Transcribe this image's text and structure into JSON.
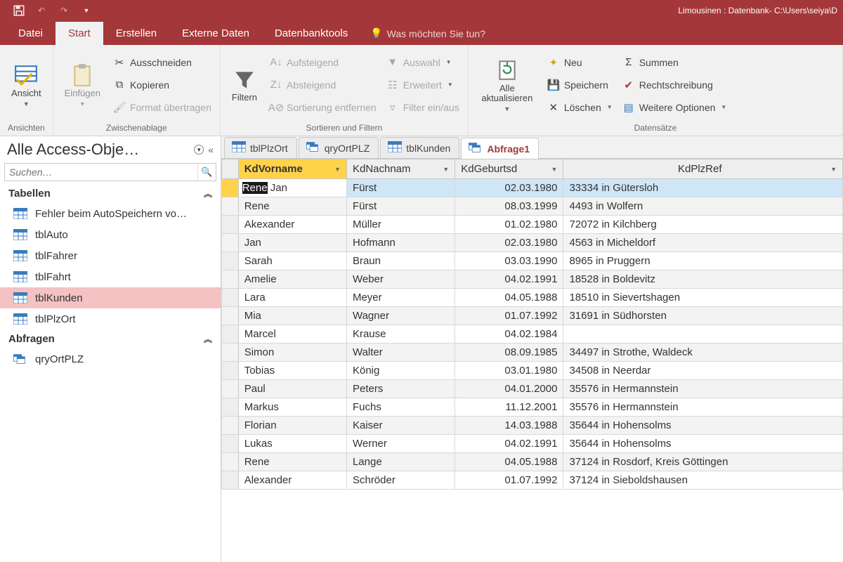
{
  "window": {
    "title": "Limousinen : Datenbank- C:\\Users\\seiya\\D"
  },
  "menu": {
    "tabs": [
      "Datei",
      "Start",
      "Erstellen",
      "Externe Daten",
      "Datenbanktools"
    ],
    "tell_me": "Was möchten Sie tun?"
  },
  "ribbon": {
    "ansichten": {
      "ansicht": "Ansicht",
      "group": "Ansichten"
    },
    "clipboard": {
      "einfuegen": "Einfügen",
      "ausschneiden": "Ausschneiden",
      "kopieren": "Kopieren",
      "format": "Format übertragen",
      "group": "Zwischenablage"
    },
    "sortfilter": {
      "filtern": "Filtern",
      "auf": "Aufsteigend",
      "ab": "Absteigend",
      "entf": "Sortierung entfernen",
      "auswahl": "Auswahl",
      "erweitert": "Erweitert",
      "einaus": "Filter ein/aus",
      "group": "Sortieren und Filtern"
    },
    "records": {
      "refresh": "Alle aktualisieren",
      "neu": "Neu",
      "speichern": "Speichern",
      "loeschen": "Löschen",
      "summen": "Summen",
      "recht": "Rechtschreibung",
      "weitere": "Weitere Optionen",
      "group": "Datensätze"
    }
  },
  "nav": {
    "title": "Alle Access-Obje…",
    "search_ph": "Suchen…",
    "cat_tabellen": "Tabellen",
    "cat_abfragen": "Abfragen",
    "items_tables": [
      "Fehler beim AutoSpeichern vo…",
      "tblAuto",
      "tblFahrer",
      "tblFahrt",
      "tblKunden",
      "tblPlzOrt"
    ],
    "items_queries": [
      "qryOrtPLZ"
    ]
  },
  "doctabs": [
    {
      "label": "tblPlzOrt",
      "type": "table"
    },
    {
      "label": "qryOrtPLZ",
      "type": "query"
    },
    {
      "label": "tblKunden",
      "type": "table"
    },
    {
      "label": "Abfrage1",
      "type": "query",
      "active": true
    }
  ],
  "grid": {
    "columns": [
      "KdVorname",
      "KdNachnam",
      "KdGeburtsd",
      "KdPlzRef"
    ],
    "edit_prefix": "Rene",
    "edit_suffix": " Jan",
    "rows": [
      {
        "v": "Rene Jan",
        "n": "Fürst",
        "g": "02.03.1980",
        "p": "33334 in Gütersloh",
        "sel": true
      },
      {
        "v": "Rene",
        "n": "Fürst",
        "g": "08.03.1999",
        "p": "4493 in Wolfern"
      },
      {
        "v": "Akexander",
        "n": "Müller",
        "g": "01.02.1980",
        "p": "72072 in Kilchberg"
      },
      {
        "v": "Jan",
        "n": "Hofmann",
        "g": "02.03.1980",
        "p": "4563 in Micheldorf"
      },
      {
        "v": "Sarah",
        "n": "Braun",
        "g": "03.03.1990",
        "p": "8965 in Pruggern"
      },
      {
        "v": "Amelie",
        "n": "Weber",
        "g": "04.02.1991",
        "p": "18528 in Boldevitz"
      },
      {
        "v": "Lara",
        "n": "Meyer",
        "g": "04.05.1988",
        "p": "18510 in Sievertshagen"
      },
      {
        "v": "Mia",
        "n": "Wagner",
        "g": "01.07.1992",
        "p": "31691 in Südhorsten"
      },
      {
        "v": "Marcel",
        "n": "Krause",
        "g": "04.02.1984",
        "p": ""
      },
      {
        "v": "Simon",
        "n": "Walter",
        "g": "08.09.1985",
        "p": "34497 in Strothe, Waldeck"
      },
      {
        "v": "Tobias",
        "n": "König",
        "g": "03.01.1980",
        "p": "34508 in Neerdar"
      },
      {
        "v": "Paul",
        "n": "Peters",
        "g": "04.01.2000",
        "p": "35576 in Hermannstein"
      },
      {
        "v": "Markus",
        "n": "Fuchs",
        "g": "11.12.2001",
        "p": "35576 in Hermannstein"
      },
      {
        "v": "Florian",
        "n": "Kaiser",
        "g": "14.03.1988",
        "p": "35644 in Hohensolms"
      },
      {
        "v": "Lukas",
        "n": "Werner",
        "g": "04.02.1991",
        "p": "35644 in Hohensolms"
      },
      {
        "v": "Rene",
        "n": "Lange",
        "g": "04.05.1988",
        "p": "37124 in Rosdorf, Kreis Göttingen"
      },
      {
        "v": "Alexander",
        "n": "Schröder",
        "g": "01.07.1992",
        "p": "37124 in Sieboldshausen"
      }
    ]
  }
}
